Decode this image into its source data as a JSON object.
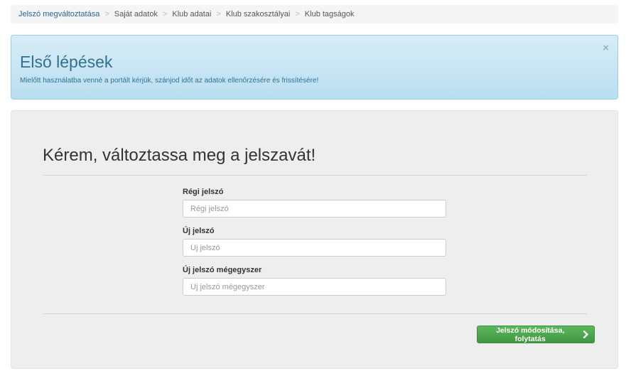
{
  "breadcrumb": {
    "items": [
      {
        "label": "Jelszó megváltoztatása",
        "active": true
      },
      {
        "label": "Saját adatok"
      },
      {
        "label": "Klub adatai"
      },
      {
        "label": "Klub szakosztályai"
      },
      {
        "label": "Klub tagságok"
      }
    ],
    "separator": ">"
  },
  "alert": {
    "title": "Első lépések",
    "text": "Mielőtt használatba venné a portált kérjük, szánjod időt az adatok ellenőrzésére és frissítésére!",
    "close": "×"
  },
  "form": {
    "heading": "Kérem, változtassa meg a jelszavát!",
    "fields": [
      {
        "label": "Régi jelszó",
        "placeholder": "Régi jelszó",
        "value": ""
      },
      {
        "label": "Új jelszó",
        "placeholder": "Új jelszó",
        "value": ""
      },
      {
        "label": "Új jelszó mégegyszer",
        "placeholder": "Új jelszó mégegyszer",
        "value": ""
      }
    ],
    "submit_label": "Jelszó módosítása, folytatás",
    "submit_icon": "chevron-right-icon"
  },
  "colors": {
    "link": "#2a6496",
    "alert_text": "#31708f",
    "success": "#5cb85c"
  }
}
